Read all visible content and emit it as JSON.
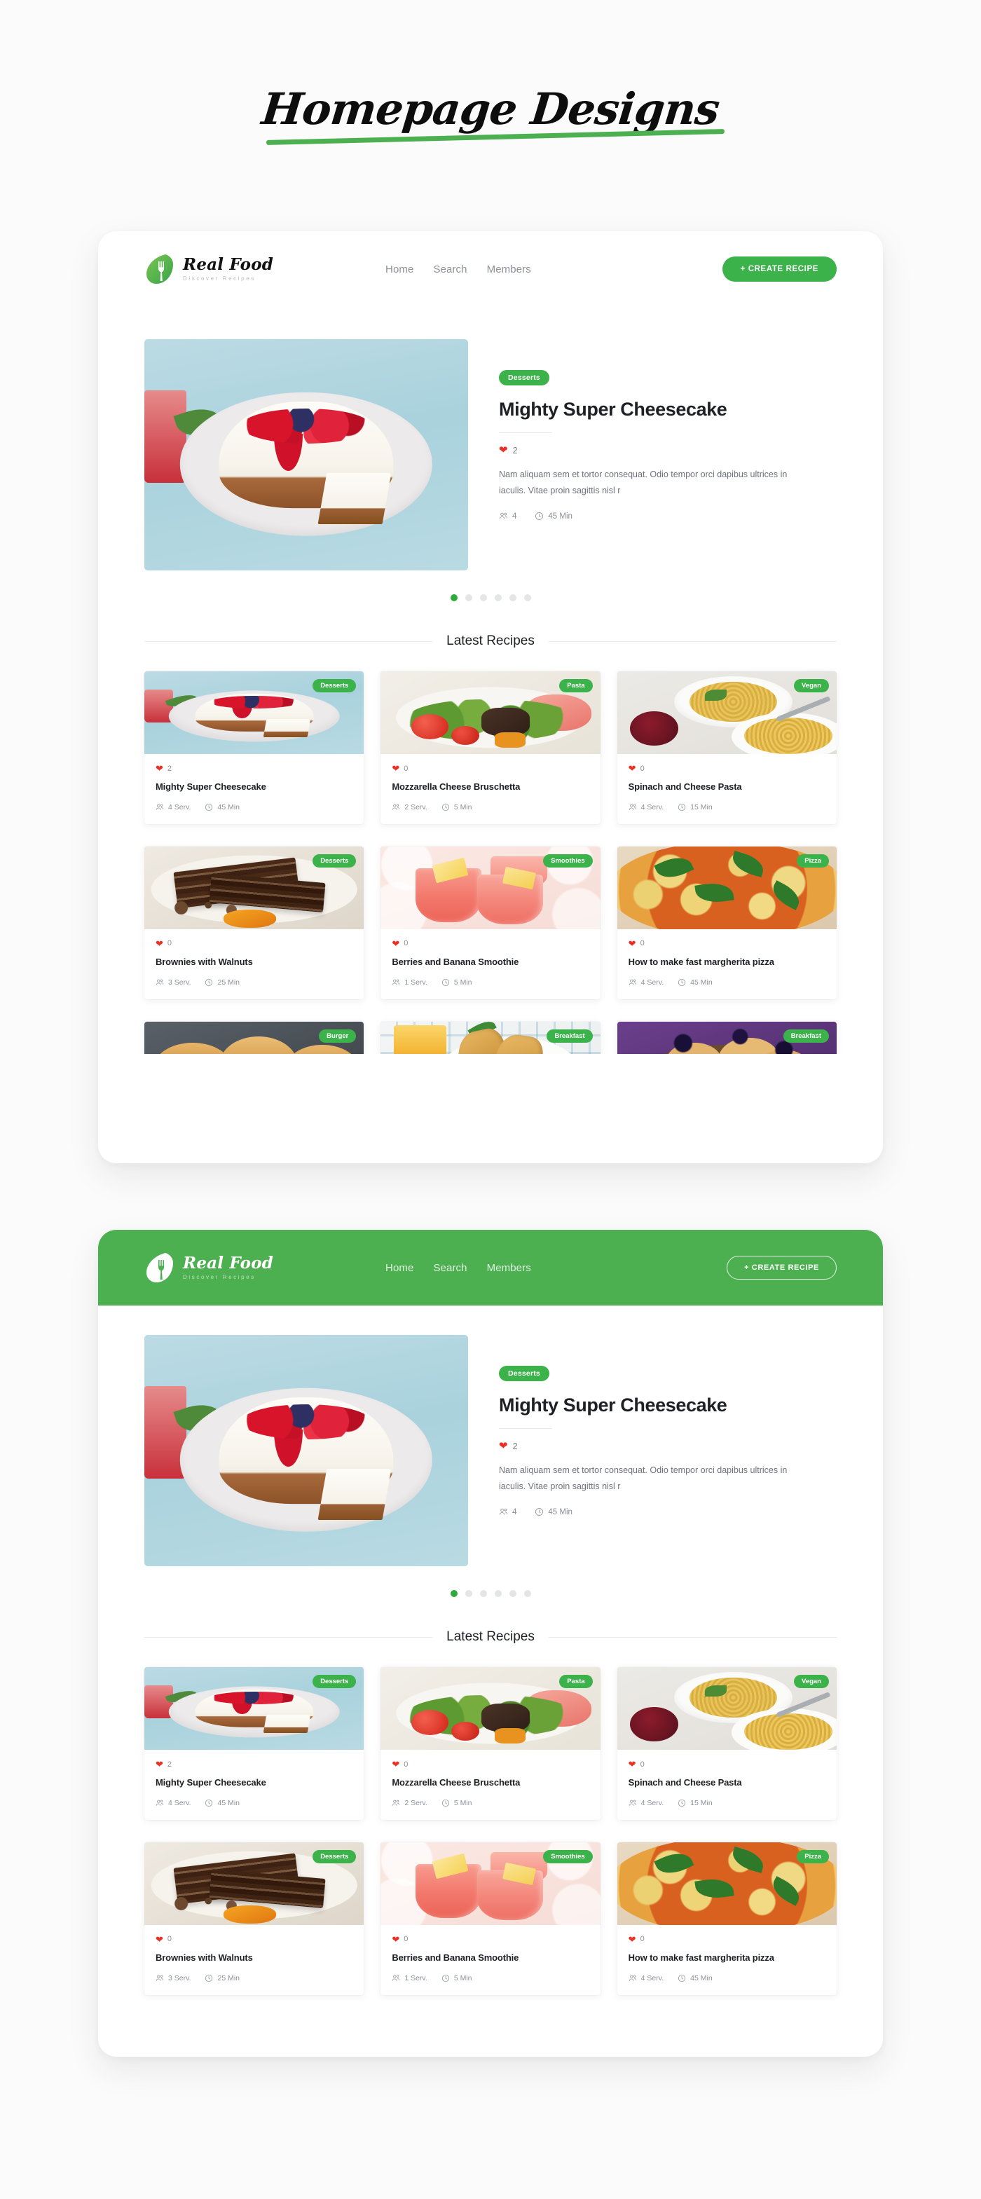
{
  "page_title": "Homepage Designs",
  "brand": {
    "name": "Real Food",
    "tagline": "Discover Recipes",
    "logo_icon": "leaf-fork-icon"
  },
  "colors": {
    "green": "#3cb24a",
    "green_header": "#4cb050",
    "heart_red": "#ed3024",
    "text_dark": "#1d2025",
    "text_muted": "#8c9099",
    "page_bg": "#fbfbfb",
    "panel_bg": "#ffffff"
  },
  "nav": {
    "items": [
      "Home",
      "Search",
      "Members"
    ],
    "cta_label": "+ CREATE RECIPE"
  },
  "hero": {
    "badge": "Desserts",
    "title": "Mighty Super Cheesecake",
    "likes": "2",
    "description": "Nam aliquam sem et tortor consequat. Odio tempor orci dapibus ultrices in iaculis. Vitae proin sagittis nisl r",
    "servings": "4",
    "time": "45 Min",
    "carousel": {
      "total": 6,
      "active_index": 0
    }
  },
  "section": {
    "latest_recipes_title": "Latest Recipes"
  },
  "recipes": [
    {
      "badge": "Desserts",
      "title": "Mighty Super Cheesecake",
      "likes": "2",
      "servings": "4 Serv.",
      "time": "45 Min",
      "art": "cheese"
    },
    {
      "badge": "Pasta",
      "title": "Mozzarella Cheese Bruschetta",
      "likes": "0",
      "servings": "2 Serv.",
      "time": "5 Min",
      "art": "salad"
    },
    {
      "badge": "Vegan",
      "title": "Spinach and Cheese Pasta",
      "likes": "0",
      "servings": "4 Serv.",
      "time": "15 Min",
      "art": "pasta"
    },
    {
      "badge": "Desserts",
      "title": "Brownies with Walnuts",
      "likes": "0",
      "servings": "3 Serv.",
      "time": "25 Min",
      "art": "brownie"
    },
    {
      "badge": "Smoothies",
      "title": "Berries and Banana Smoothie",
      "likes": "0",
      "servings": "1 Serv.",
      "time": "5 Min",
      "art": "smooth"
    },
    {
      "badge": "Pizza",
      "title": "How to make fast margherita pizza",
      "likes": "0",
      "servings": "4 Serv.",
      "time": "45 Min",
      "art": "pizza"
    }
  ],
  "recipes_partial": [
    {
      "badge": "Burger",
      "art": "burger"
    },
    {
      "badge": "Breakfast",
      "art": "croi"
    },
    {
      "badge": "Breakfast",
      "art": "muffin"
    }
  ],
  "icons": {
    "heart": "heart-icon",
    "servings": "people-icon",
    "time": "clock-icon"
  }
}
